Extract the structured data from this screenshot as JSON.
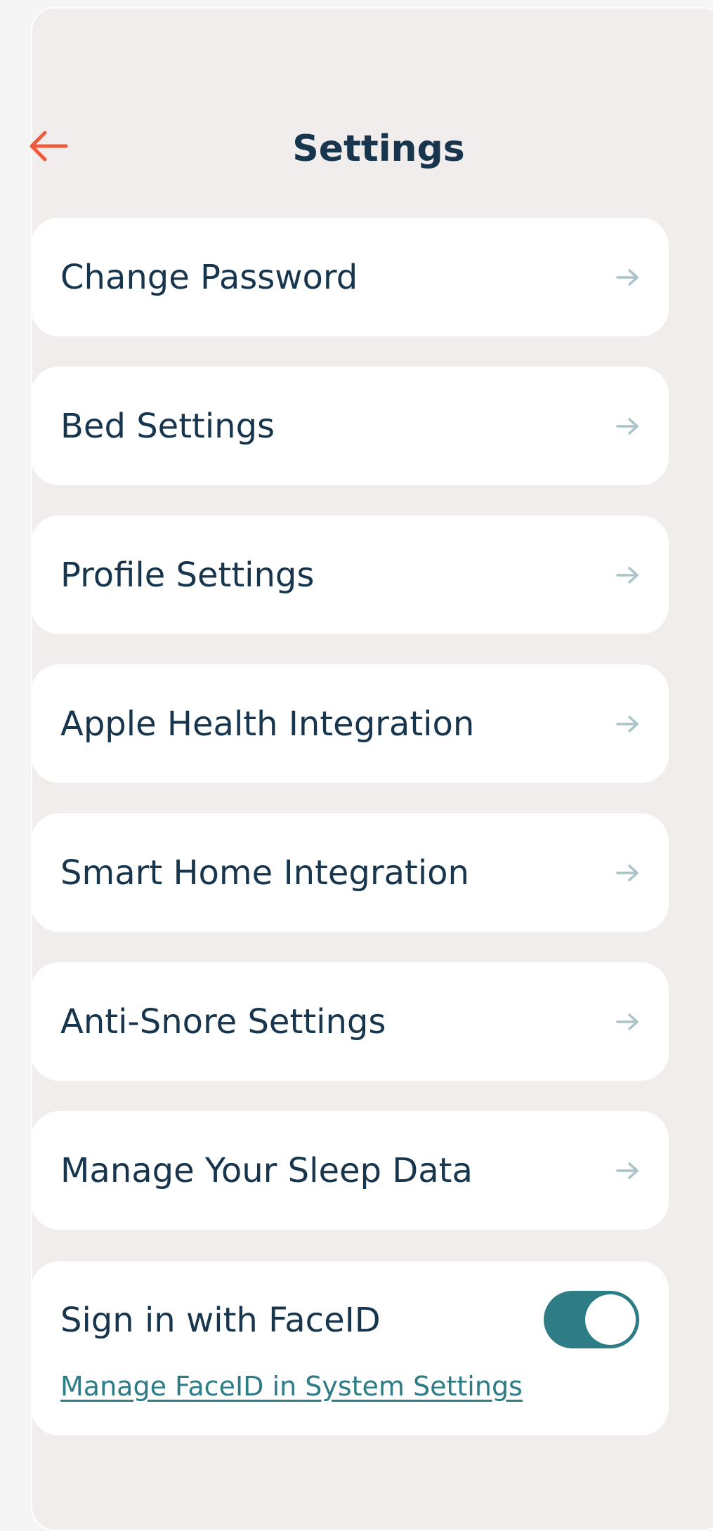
{
  "header": {
    "title": "Settings",
    "back_icon": "arrow-left-icon",
    "back_color": "#f05a3c"
  },
  "menu": {
    "items": [
      {
        "label": "Change Password",
        "icon": "arrow-right-icon"
      },
      {
        "label": "Bed Settings",
        "icon": "arrow-right-icon"
      },
      {
        "label": "Profile Settings",
        "icon": "arrow-right-icon"
      },
      {
        "label": "Apple Health Integration",
        "icon": "arrow-right-icon"
      },
      {
        "label": "Smart Home Integration",
        "icon": "arrow-right-icon"
      },
      {
        "label": "Anti-Snore Settings",
        "icon": "arrow-right-icon"
      },
      {
        "label": "Manage Your Sleep Data",
        "icon": "arrow-right-icon"
      }
    ]
  },
  "faceid": {
    "label": "Sign in with FaceID",
    "enabled": true,
    "link": "Manage FaceID in System Settings",
    "toggle_color": "#2e7c86"
  },
  "colors": {
    "text": "#17354c",
    "background": "#f1edec",
    "card": "#ffffff",
    "arrow": "#a9c4c6"
  }
}
